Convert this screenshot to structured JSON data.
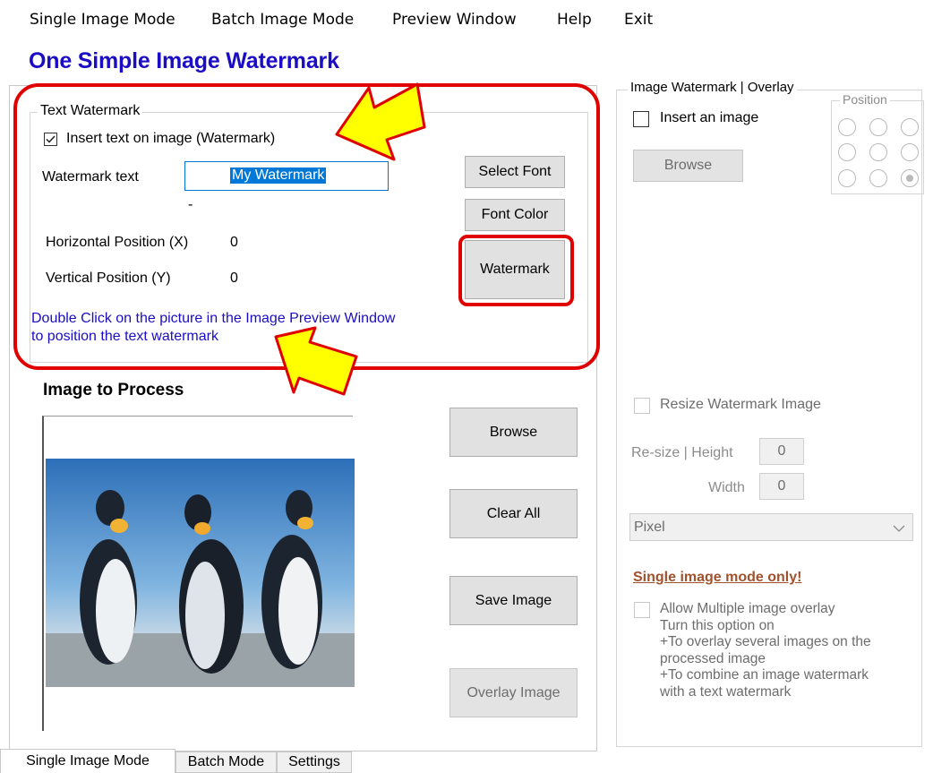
{
  "menu": {
    "items": [
      "Single Image Mode",
      "Batch Image Mode",
      "Preview Window",
      "Help",
      "Exit"
    ]
  },
  "app_title": "One Simple Image Watermark",
  "text_watermark": {
    "group_label": "Text Watermark",
    "insert_checkbox_label": "Insert text on image (Watermark)",
    "insert_checked": true,
    "watermark_text_label": "Watermark text",
    "watermark_text_value": "My Watermark",
    "dash": "-",
    "select_font_label": "Select Font",
    "font_color_label": "Font Color",
    "watermark_button_label": "Watermark",
    "horizontal_label": "Horizontal Position (X)",
    "horizontal_value": "0",
    "vertical_label": "Vertical Position (Y)",
    "vertical_value": "0",
    "note_line1": "Double Click on the picture in the Image Preview Window",
    "note_line2": "to position the text watermark"
  },
  "image_to_process": {
    "heading": "Image to Process",
    "browse_label": "Browse",
    "clear_all_label": "Clear All",
    "save_image_label": "Save Image",
    "overlay_image_label": "Overlay Image"
  },
  "image_watermark": {
    "group_label": "Image Watermark | Overlay",
    "insert_image_label": "Insert an image",
    "insert_image_checked": false,
    "browse_label": "Browse",
    "position_label": "Position",
    "position_selected": 9,
    "resize_label": "Resize Watermark Image",
    "resize_height_label": "Re-size | Height",
    "height_value": "0",
    "width_label": "Width",
    "width_value": "0",
    "unit_select_value": "Pixel",
    "single_mode_note": "Single image mode only!",
    "allow_multi_label": "Allow Multiple image overlay",
    "allow_multi_lines": [
      "Turn this option on",
      "+To overlay several images on the",
      "processed image",
      "+To combine an image watermark",
      "with a text watermark"
    ]
  },
  "tabs": [
    "Single Image Mode",
    "Batch Mode",
    "Settings"
  ],
  "colors": {
    "title_blue": "#1a0dc4",
    "annotation_red": "#e00000",
    "annotation_arrow_yellow": "#ffff00",
    "selection_blue": "#0078d7",
    "single_mode_note": "#a0522d"
  }
}
